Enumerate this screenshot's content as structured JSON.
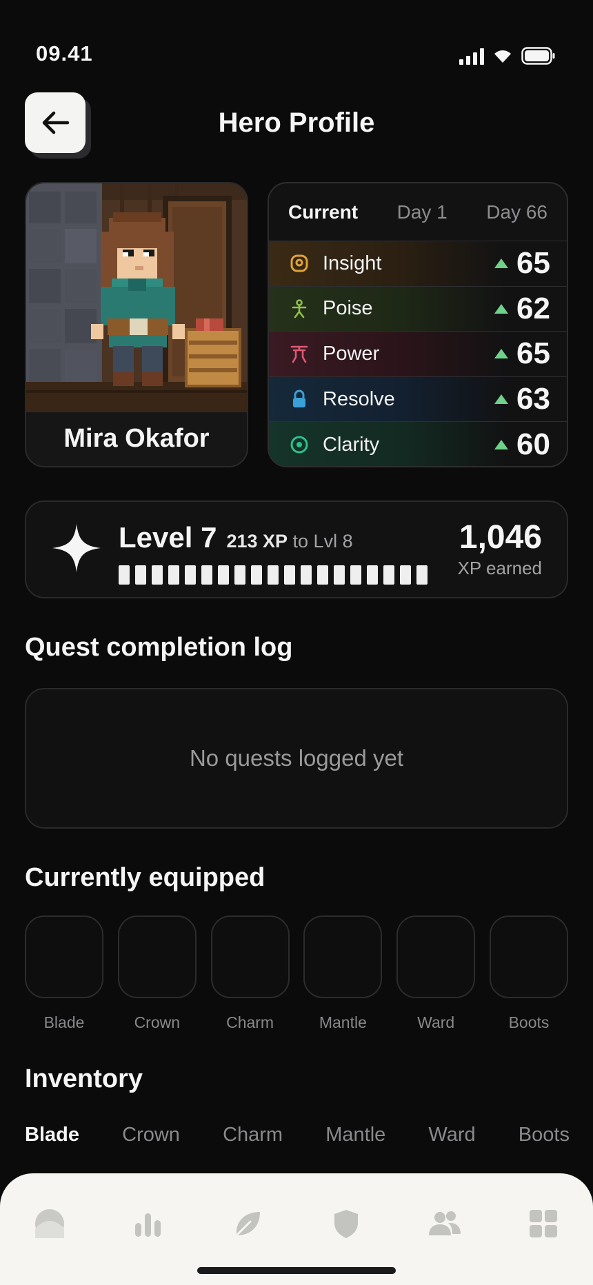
{
  "status_bar": {
    "time": "09.41"
  },
  "header": {
    "title": "Hero Profile"
  },
  "hero": {
    "name": "Mira Okafor"
  },
  "stats": {
    "tabs": [
      {
        "label": "Current",
        "active": true
      },
      {
        "label": "Day 1",
        "active": false
      },
      {
        "label": "Day 66",
        "active": false
      }
    ],
    "rows": [
      {
        "label": "Insight",
        "value": "65",
        "icon": "insight-icon",
        "color": "#e0a23a",
        "tint": "#3a2a15"
      },
      {
        "label": "Poise",
        "value": "62",
        "icon": "person-icon",
        "color": "#8fc24a",
        "tint": "#25311a"
      },
      {
        "label": "Power",
        "value": "65",
        "icon": "power-icon",
        "color": "#e05a72",
        "tint": "#3a1a24"
      },
      {
        "label": "Resolve",
        "value": "63",
        "icon": "lock-icon",
        "color": "#3aa0d8",
        "tint": "#15293a"
      },
      {
        "label": "Clarity",
        "value": "60",
        "icon": "target-icon",
        "color": "#2fbf8a",
        "tint": "#15342a"
      }
    ]
  },
  "level": {
    "label": "Level 7",
    "xp_needed": "213 XP",
    "xp_next": "to Lvl 8",
    "progress_segments": 19,
    "total_xp": "1,046",
    "total_label": "XP earned"
  },
  "quest_log": {
    "title": "Quest completion log",
    "empty_text": "No quests logged yet"
  },
  "equipped": {
    "title": "Currently equipped",
    "slots": [
      "Blade",
      "Crown",
      "Charm",
      "Mantle",
      "Ward",
      "Boots"
    ]
  },
  "inventory": {
    "title": "Inventory",
    "tabs": [
      {
        "label": "Blade",
        "active": true
      },
      {
        "label": "Crown",
        "active": false
      },
      {
        "label": "Charm",
        "active": false
      },
      {
        "label": "Mantle",
        "active": false
      },
      {
        "label": "Ward",
        "active": false
      },
      {
        "label": "Boots",
        "active": false
      }
    ]
  },
  "bottom_nav": {
    "items": [
      "home-icon",
      "stats-icon",
      "leaf-icon",
      "shield-icon",
      "friends-icon",
      "grid-icon"
    ]
  }
}
